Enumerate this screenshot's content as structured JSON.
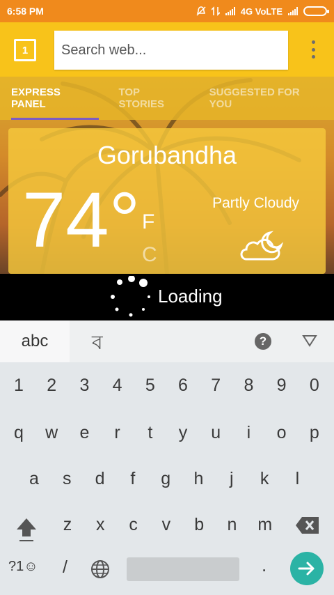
{
  "status_bar": {
    "time": "6:58 PM",
    "network_label": "4G VoLTE"
  },
  "toolbar": {
    "tab_count": "1",
    "search_placeholder": "Search web..."
  },
  "tabs": [
    {
      "label": "EXPRESS PANEL",
      "active": true
    },
    {
      "label": "TOP STORIES",
      "active": false
    },
    {
      "label": "SUGGESTED FOR YOU",
      "active": false
    }
  ],
  "weather": {
    "city": "Gorubandha",
    "temperature": "74°",
    "unit_f": "F",
    "unit_c": "C",
    "condition": "Partly Cloudy",
    "icon": "partly-cloudy-night-icon"
  },
  "loading": {
    "text": "Loading"
  },
  "keyboard": {
    "mode_label": "abc",
    "alt_script_label": "ব",
    "help_label": "?",
    "number_row": [
      "1",
      "2",
      "3",
      "4",
      "5",
      "6",
      "7",
      "8",
      "9",
      "0"
    ],
    "row1": [
      "q",
      "w",
      "e",
      "r",
      "t",
      "y",
      "u",
      "i",
      "o",
      "p"
    ],
    "row2": [
      "a",
      "s",
      "d",
      "f",
      "g",
      "h",
      "j",
      "k",
      "l"
    ],
    "row3": [
      "z",
      "x",
      "c",
      "v",
      "b",
      "n",
      "m"
    ],
    "symbols_label": "?1☺",
    "slash_label": "/",
    "period_label": "."
  },
  "colors": {
    "status_bar": "#f08a1c",
    "toolbar": "#f8c31a",
    "tab_indicator": "#7d5cc2",
    "go_button": "#2bb3a5"
  }
}
